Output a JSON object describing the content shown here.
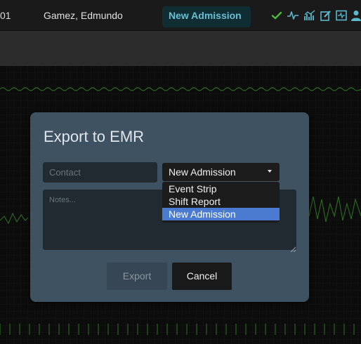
{
  "header": {
    "bed_id": "01",
    "patient_name": "Gamez, Edmundo",
    "status_label": "New Admission",
    "icons": [
      "check-icon",
      "heartbeat-icon",
      "trend-chart-icon",
      "edit-icon",
      "monitor-icon",
      "person-icon"
    ]
  },
  "colors": {
    "header_bg": "#1a1a1a",
    "status_pill_bg": "#0f2d33",
    "status_text": "#69bfd4",
    "modal_bg": "#3e5262",
    "waveform": "#2e6b23",
    "selected_option": "#4a7bd1"
  },
  "modal": {
    "title": "Export to EMR",
    "contact_placeholder": "Contact",
    "notes_placeholder": "Notes...",
    "type_select": {
      "value": "New Admission",
      "options": [
        "Event Strip",
        "Shift Report",
        "New Admission"
      ],
      "selected_index": 2
    },
    "export_label": "Export",
    "cancel_label": "Cancel"
  }
}
